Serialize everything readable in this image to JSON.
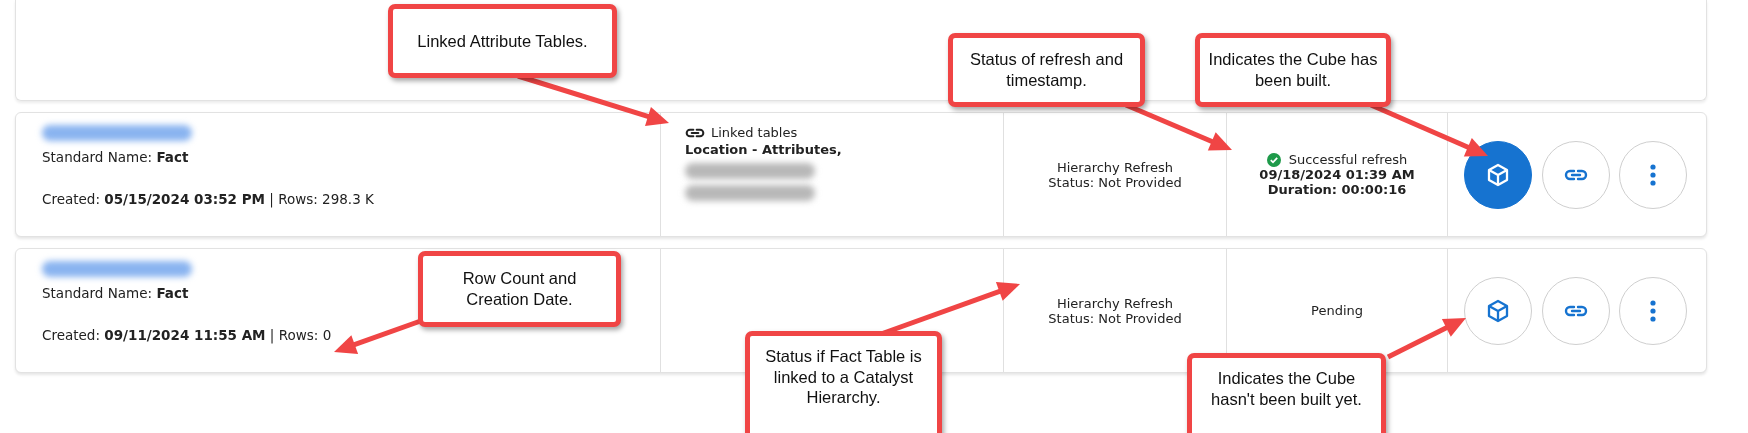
{
  "rows": [
    {
      "standard_name": "Standard Name: **Fact**",
      "created": "Created: **05/15/2024 03:52 PM** | Rows: 298.3 K",
      "linked_tables": {
        "label": "Linked tables",
        "tables": [
          "Location - Attributes,"
        ]
      },
      "hierarchy_status": [
        "Hierarchy Refresh",
        "Status: Not Provided"
      ],
      "refresh": {
        "kind": "success",
        "text": "Successful refresh",
        "timestamp": "09/18/2024 01:39 AM",
        "duration": "Duration: 00:00:16"
      },
      "cube_built": true
    },
    {
      "standard_name": "Standard Name: **Fact**",
      "created": "Created: **09/11/2024 11:55 AM** | Rows: 0",
      "hierarchy_status": [
        "Hierarchy Refresh",
        "Status: Not Provided"
      ],
      "refresh": {
        "kind": "pending",
        "text": "Pending"
      },
      "cube_built": false
    }
  ],
  "callouts": [
    {
      "text": "Linked Attribute Tables."
    },
    {
      "text": "Status of refresh and timestamp."
    },
    {
      "text": "Indicates the Cube has been built."
    },
    {
      "text": "Row Count and Creation Date."
    },
    {
      "text": "Status if Fact Table is linked to a Catalyst Hierarchy."
    },
    {
      "text": "Indicates the Cube hasn't been built yet."
    }
  ]
}
